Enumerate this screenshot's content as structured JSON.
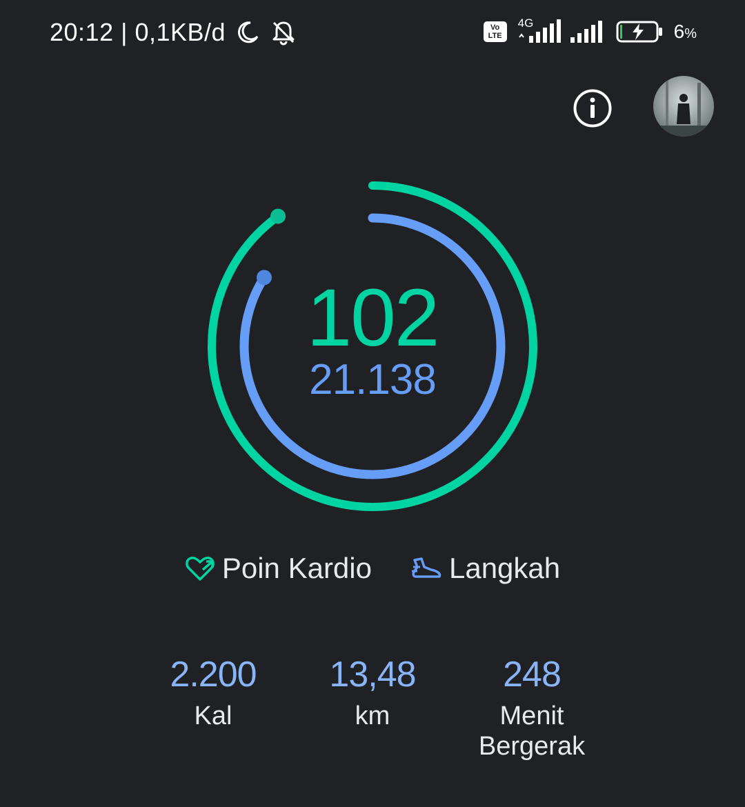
{
  "status_bar": {
    "time_network": "20:12 | 0,1KB/d",
    "volte_top": "Vo",
    "volte_bottom": "LTE",
    "network_type": "4G",
    "battery_percent": "6",
    "battery_unit": "%",
    "battery_level": 0.06
  },
  "rings": {
    "cardio_points": "102",
    "steps": "21.138",
    "cardio_color": "#00d4a2",
    "steps_color": "#669df6",
    "cardio_progress": 0.9,
    "steps_progress": 0.84
  },
  "legend": {
    "cardio_label": "Poin Kardio",
    "steps_label": "Langkah"
  },
  "stats": [
    {
      "value": "2.200",
      "label": "Kal"
    },
    {
      "value": "13,48",
      "label": "km"
    },
    {
      "value": "248",
      "label": "Menit",
      "label2": "Bergerak"
    }
  ],
  "icons": {
    "info": "info-icon",
    "profile": "avatar",
    "moon": "moon-icon",
    "bell_off": "bell-off-icon"
  }
}
